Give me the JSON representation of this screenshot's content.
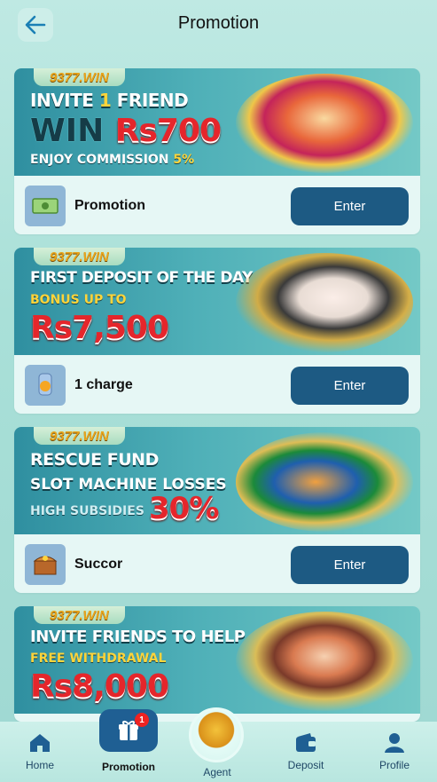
{
  "header": {
    "title": "Promotion",
    "back_icon": "arrow-left-icon"
  },
  "cards": [
    {
      "tag": "9377.WIN",
      "line1_pre": "INVITE ",
      "line1_hl": "1",
      "line1_post": " FRIEND",
      "line2_pre": "WIN ",
      "line2_big": "Rs700",
      "line3_pre": "ENJOY COMMISSION ",
      "line3_hl": "5%",
      "label": "Promotion",
      "button": "Enter",
      "icon": "money-icon"
    },
    {
      "tag": "9377.WIN",
      "line1": "FIRST DEPOSIT OF THE DAY",
      "line2": "BONUS UP TO",
      "big": "Rs7,500",
      "label": "1 charge",
      "button": "Enter",
      "icon": "coin-hand-icon"
    },
    {
      "tag": "9377.WIN",
      "line1": "RESCUE FUND",
      "line2": "SLOT MACHINE LOSSES",
      "line3": "HIGH SUBSIDIES",
      "big": "30%",
      "label": "Succor",
      "button": "Enter",
      "icon": "treasure-chest-icon"
    },
    {
      "tag": "9377.WIN",
      "line1": "INVITE FRIENDS TO HELP",
      "line2": "FREE WITHDRAWAL",
      "big": "Rs8,000"
    }
  ],
  "nav": {
    "home": "Home",
    "promotion": "Promotion",
    "promotion_badge": "1",
    "agent": "Agent",
    "deposit": "Deposit",
    "profile": "Profile"
  },
  "colors": {
    "accent": "#1d5a83",
    "background": "#a9e0d8",
    "badge": "#e22222"
  }
}
